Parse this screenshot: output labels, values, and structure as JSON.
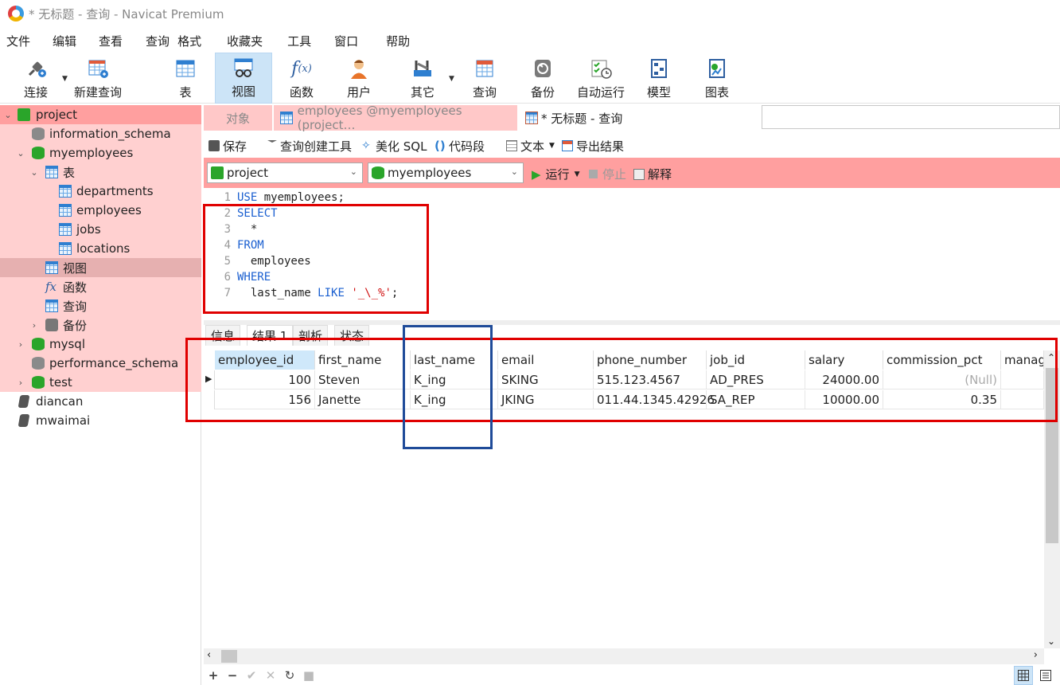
{
  "window": {
    "title": "* 无标题 - 查询 - Navicat Premium"
  },
  "menu": [
    "文件",
    "编辑",
    "查看",
    "查询",
    "格式",
    "收藏夹",
    "工具",
    "窗口",
    "帮助"
  ],
  "toolbar": {
    "connect": "连接",
    "new_query": "新建查询",
    "table": "表",
    "view": "视图",
    "function": "函数",
    "user": "用户",
    "other": "其它",
    "query": "查询",
    "backup": "备份",
    "auto_run": "自动运行",
    "model": "模型",
    "chart": "图表"
  },
  "tree": {
    "project": "project",
    "information_schema": "information_schema",
    "myemployees": "myemployees",
    "tables": "表",
    "departments": "departments",
    "employees": "employees",
    "jobs": "jobs",
    "locations": "locations",
    "views": "视图",
    "functions": "函数",
    "queries": "查询",
    "backups": "备份",
    "mysql": "mysql",
    "performance_schema": "performance_schema",
    "test": "test",
    "diancan": "diancan",
    "mwaimai": "mwaimai"
  },
  "tabs": {
    "objects": "对象",
    "employees": "employees @myemployees (project…",
    "current": "* 无标题 - 查询"
  },
  "query_toolbar": {
    "save": "保存",
    "builder": "查询创建工具",
    "beautify": "美化 SQL",
    "snippet": "代码段",
    "text": "文本",
    "export": "导出结果"
  },
  "selectors": {
    "connection": "project",
    "database": "myemployees",
    "run": "运行",
    "stop": "停止",
    "explain": "解释"
  },
  "editor": {
    "line_numbers": [
      "1",
      "2",
      "3",
      "4",
      "5",
      "6",
      "7"
    ],
    "l1_kw": "USE",
    "l1_rest": " myemployees;",
    "l2_kw": "SELECT",
    "l3": "  *",
    "l4_kw": "FROM",
    "l5": "  employees",
    "l6_kw": "WHERE",
    "l7_a": "  last_name ",
    "l7_kw": "LIKE",
    "l7_sp": " ",
    "l7_str": "'_\\_%'",
    "l7_end": ";"
  },
  "result_tabs": [
    "信息",
    "结果 1",
    "剖析",
    "状态"
  ],
  "grid": {
    "columns": [
      "employee_id",
      "first_name",
      "last_name",
      "email",
      "phone_number",
      "job_id",
      "salary",
      "commission_pct",
      "manag"
    ],
    "rows": [
      [
        "100",
        "Steven",
        "K_ing",
        "SKING",
        "515.123.4567",
        "AD_PRES",
        "24000.00",
        "(Null)"
      ],
      [
        "156",
        "Janette",
        "K_ing",
        "JKING",
        "011.44.1345.42926",
        "SA_REP",
        "10000.00",
        "0.35"
      ]
    ]
  },
  "statusbar": {
    "add": "+",
    "remove": "−",
    "apply": "✔",
    "discard": "✕",
    "refresh": "↻",
    "stop": "■"
  },
  "colors": {
    "highlight_pink": "#ffd0d0",
    "strong_pink": "#ff9f9f",
    "annotation_red": "#e00000",
    "annotation_blue": "#1f4b99",
    "keyword": "#1a5fd0",
    "string": "#d01010"
  }
}
